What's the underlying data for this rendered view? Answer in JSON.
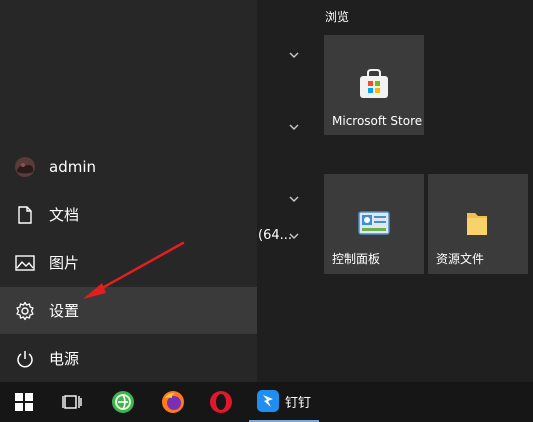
{
  "start_menu": {
    "user": {
      "name": "admin",
      "icon": "user-avatar"
    },
    "items": [
      {
        "label": "文档",
        "icon": "document-icon"
      },
      {
        "label": "图片",
        "icon": "pictures-icon"
      },
      {
        "label": "设置",
        "icon": "gear-icon"
      },
      {
        "label": "电源",
        "icon": "power-icon"
      }
    ]
  },
  "app_list": {
    "partial_text": "(64..."
  },
  "tiles": {
    "group_title": "浏览",
    "items": [
      {
        "label": "Microsoft Store",
        "icon": "store-icon"
      },
      {
        "label": "控制面板",
        "icon": "control-panel-icon"
      },
      {
        "label": "资源文件",
        "icon": "folder-icon"
      }
    ]
  },
  "taskbar": {
    "items": [
      {
        "icon": "windows-start-icon"
      },
      {
        "icon": "task-view-icon"
      },
      {
        "icon": "green-browser-icon"
      },
      {
        "icon": "firefox-icon"
      },
      {
        "icon": "opera-icon"
      },
      {
        "icon": "dingtalk-icon",
        "label": "钉钉"
      }
    ]
  },
  "colors": {
    "hover_bg": "#3a3a3a",
    "tile_bg": "#3b3b3b",
    "annotation_arrow": "#e02020"
  }
}
